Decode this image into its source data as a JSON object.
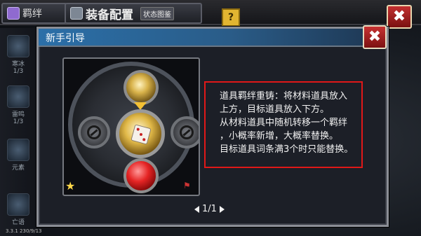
{
  "top_bar": {
    "bond_tab": "羁绊",
    "equip_tab": "装备配置",
    "status_tab": "状态图鉴",
    "help_icon": "?"
  },
  "side_list": [
    {
      "label": "寒冰",
      "count": "1/3"
    },
    {
      "label": "雷鸣",
      "count": "1/3"
    },
    {
      "label": "元素",
      "count": ""
    },
    {
      "label": "亡语",
      "count": ""
    }
  ],
  "bottom_info": "3.3.1 230/9/13",
  "dialog": {
    "title": "新手引导",
    "close_symbol": "✖",
    "text_lines": [
      "道具羁绊重铸：将材料道具放入",
      "上方，目标道具放入下方。",
      "从材料道具中随机转移一个羁绊",
      "，小概率新增，大概率替换。",
      "目标道具词条满3个时只能替换。"
    ],
    "pager": "1/1"
  },
  "colors": {
    "header_blue": "#2b6fa8",
    "highlight_red": "#e01818",
    "gold": "#e1b949"
  }
}
